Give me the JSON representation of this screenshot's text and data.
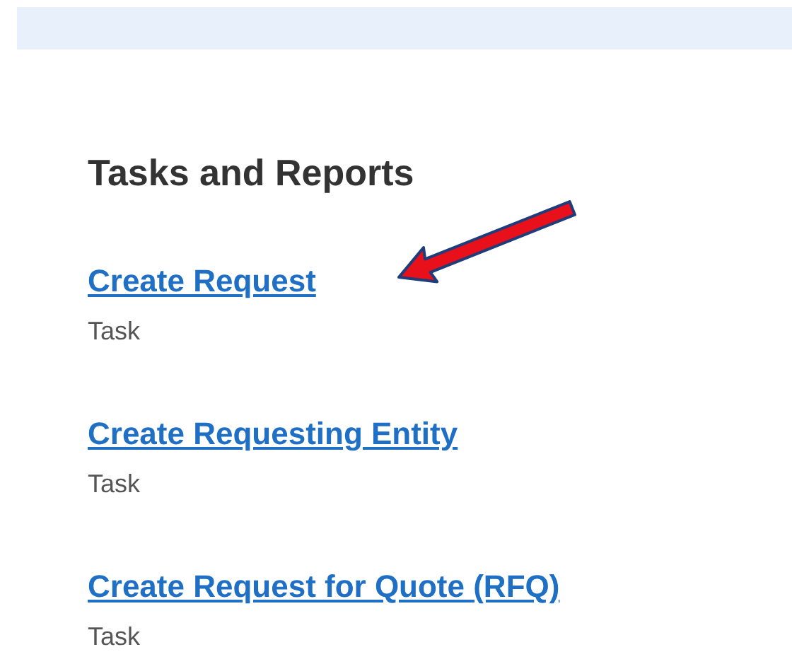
{
  "heading": "Tasks and Reports",
  "items": [
    {
      "title": "Create Request",
      "type": "Task",
      "pointed": true
    },
    {
      "title": "Create Requesting Entity",
      "type": "Task",
      "pointed": false
    },
    {
      "title": "Create Request for Quote (RFQ)",
      "type": "Task",
      "pointed": false
    }
  ]
}
